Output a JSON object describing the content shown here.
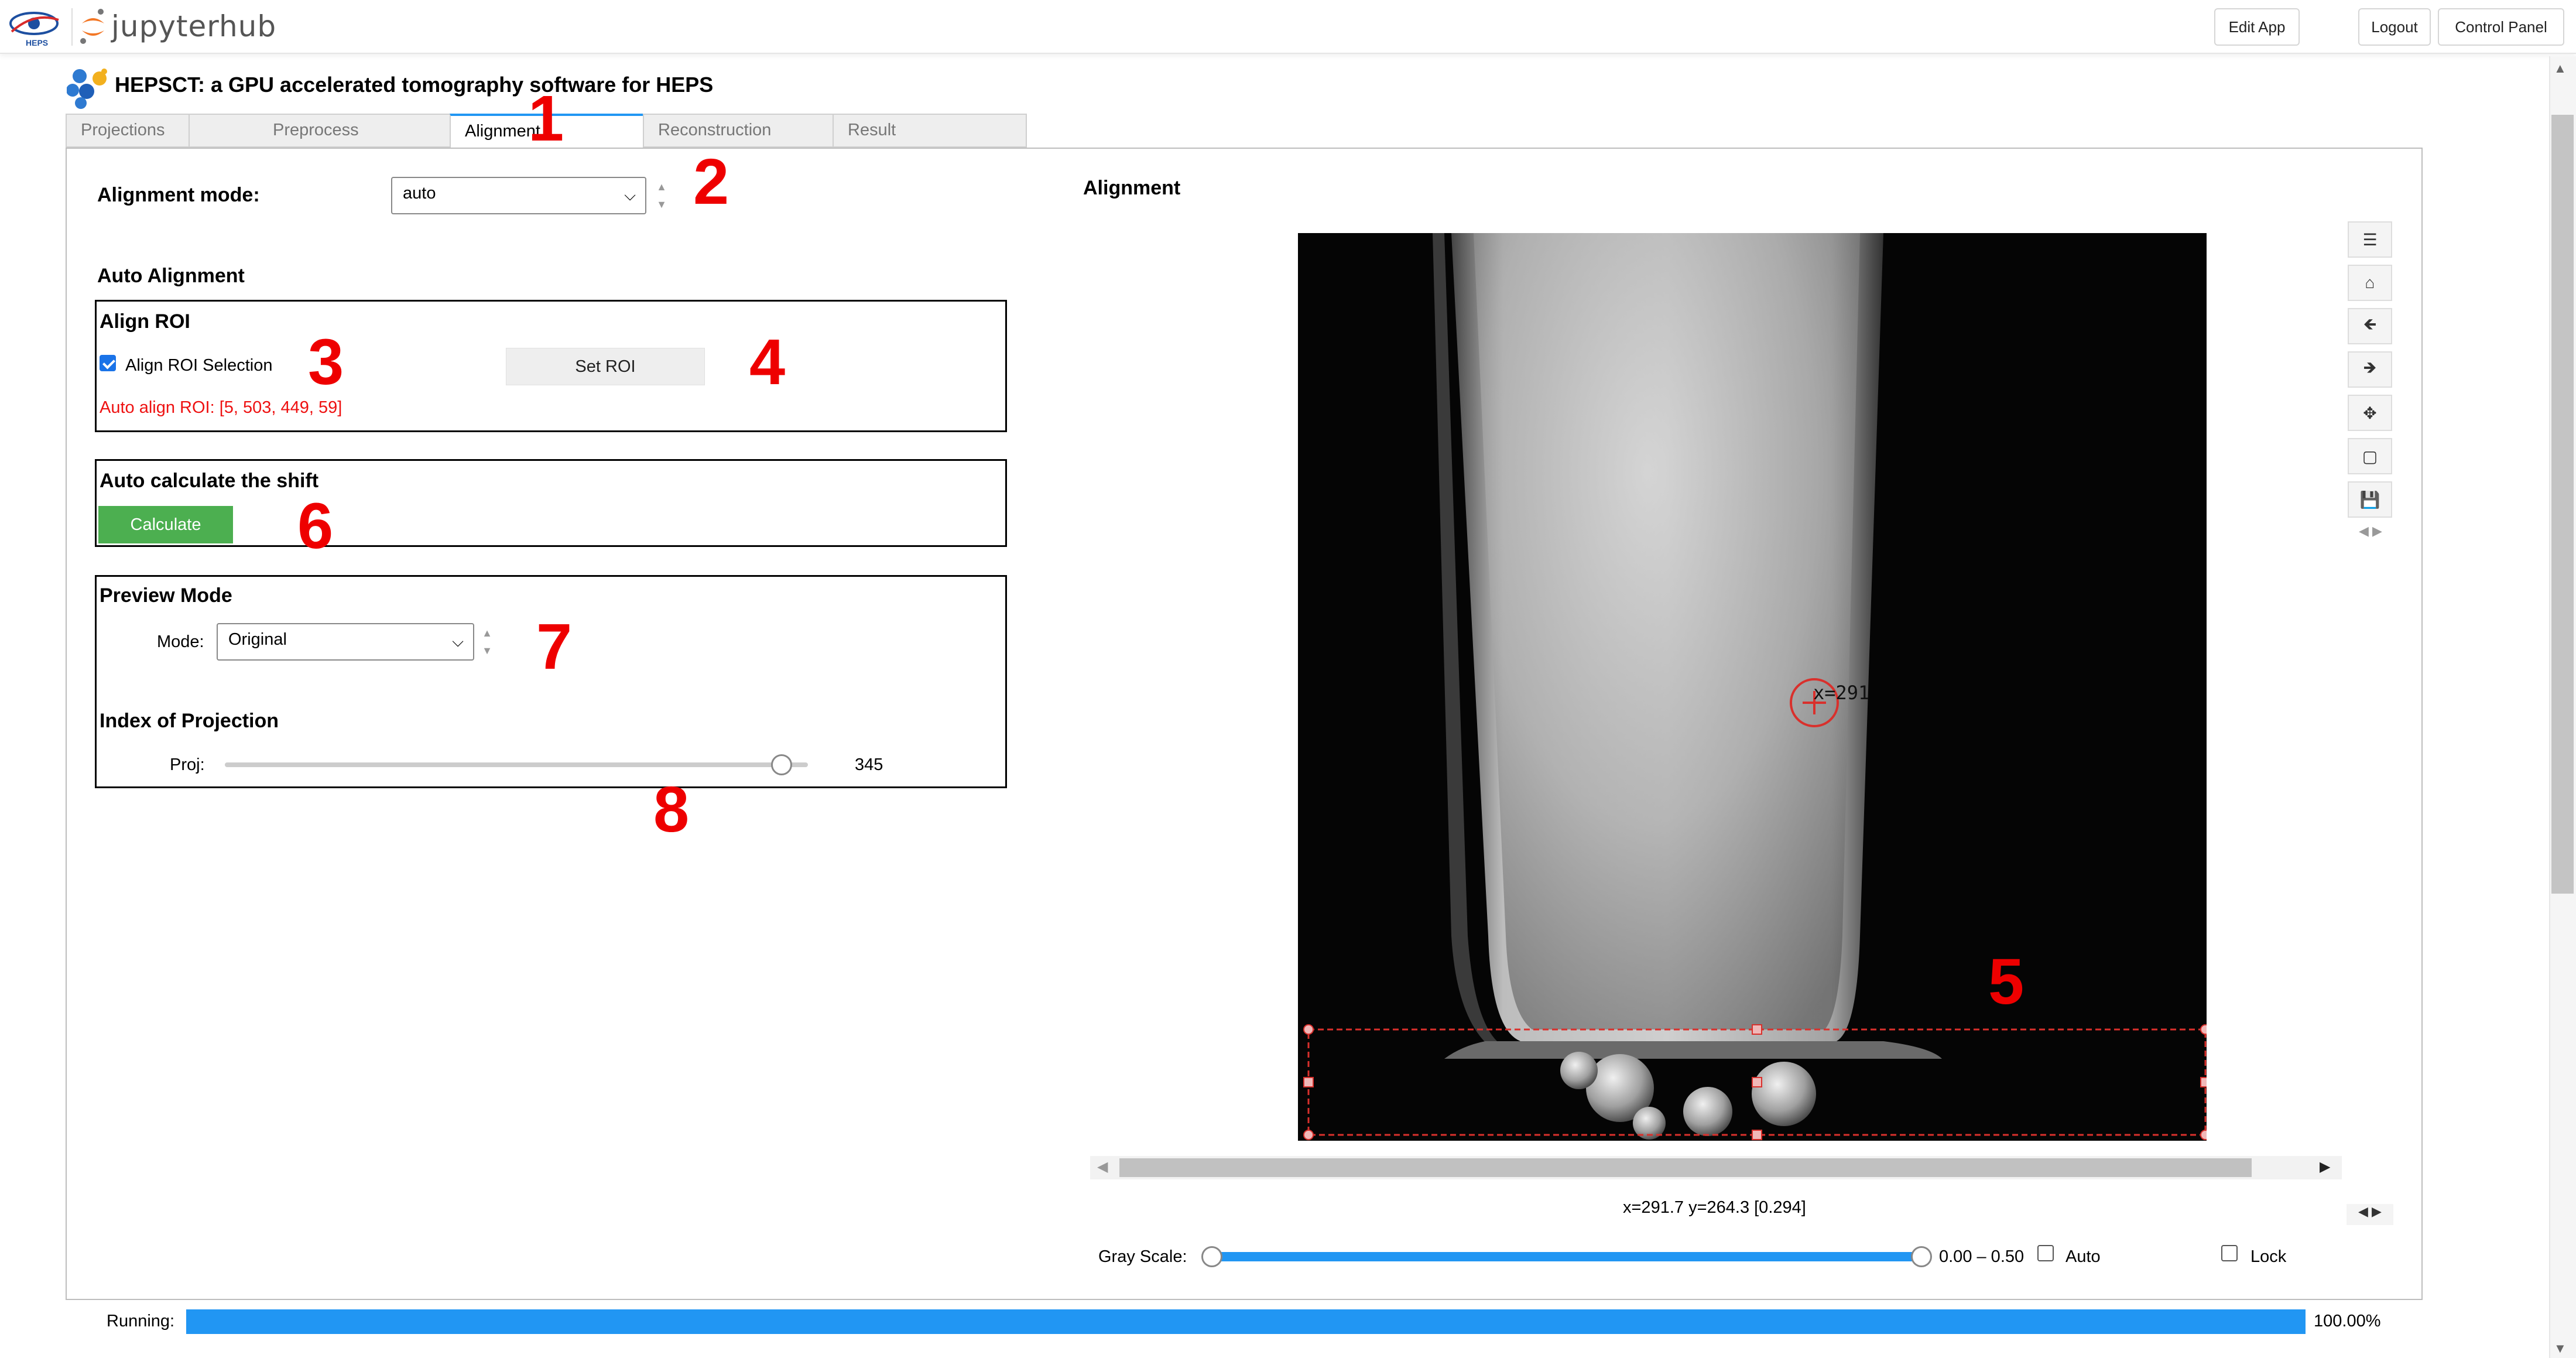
{
  "navbar": {
    "logo_text": "jupyterhub",
    "heps_logo_text": "HEPS",
    "edit_app": "Edit App",
    "logout": "Logout",
    "control_panel": "Control Panel"
  },
  "app": {
    "title": "HEPSCT: a GPU accelerated tomography software for HEPS"
  },
  "tabs": [
    {
      "label": "Projections",
      "active": false
    },
    {
      "label": "Preprocess",
      "active": false
    },
    {
      "label": "Alignment",
      "active": true
    },
    {
      "label": "Reconstruction",
      "active": false
    },
    {
      "label": "Result",
      "active": false
    }
  ],
  "left": {
    "alignment_mode_label": "Alignment mode:",
    "alignment_mode_value": "auto",
    "auto_alignment_title": "Auto Alignment",
    "align_roi": {
      "title": "Align ROI",
      "checkbox_label": "Align ROI Selection",
      "checked": true,
      "set_roi_button": "Set ROI",
      "status": "Auto align ROI: [5, 503, 449, 59]"
    },
    "auto_shift": {
      "title": "Auto calculate the shift",
      "calculate_button": "Calculate"
    },
    "preview": {
      "title": "Preview Mode",
      "mode_label": "Mode:",
      "mode_value": "Original",
      "index_title": "Index of Projection",
      "proj_label": "Proj:",
      "proj_value": "345",
      "proj_fraction": 0.955
    }
  },
  "right": {
    "title": "Alignment",
    "cursor_label": "x=291",
    "coords_readout": "x=291.7 y=264.3 [0.294]",
    "gray_scale_label": "Gray Scale:",
    "gray_scale_range": "0.00 – 0.50",
    "auto_label": "Auto",
    "auto_checked": false,
    "lock_label": "Lock",
    "lock_checked": false,
    "toolbar": [
      "menu-icon",
      "home-icon",
      "back-arrow-icon",
      "forward-arrow-icon",
      "move-icon",
      "zoom-rect-icon",
      "save-icon"
    ]
  },
  "status": {
    "running_label": "Running:",
    "progress_text": "100.00%",
    "progress_fraction": 1.0
  },
  "annotations": [
    "1",
    "2",
    "3",
    "4",
    "5",
    "6",
    "7",
    "8"
  ],
  "colors": {
    "accent": "#2196f3",
    "green_button": "#4caf50",
    "annotation_red": "#ee0000",
    "roi_red": "#d9302c",
    "jupyter_orange": "#f37726"
  }
}
